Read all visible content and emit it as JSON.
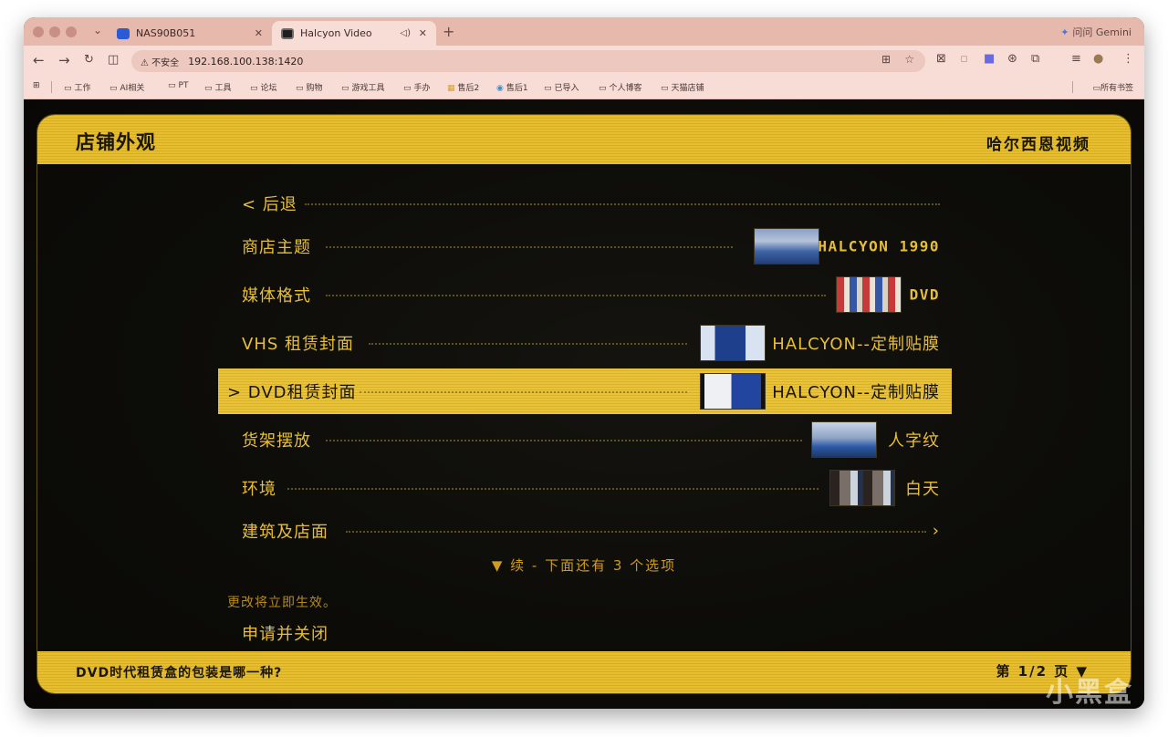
{
  "browser": {
    "tabs": [
      {
        "title": "NAS90B051"
      },
      {
        "title": "Halcyon Video"
      }
    ],
    "gemini_label": "问问 Gemini",
    "security_label": "不安全",
    "url": "192.168.100.138:1420",
    "bookmarks": [
      "工作",
      "AI相关",
      "PT",
      "工具",
      "论坛",
      "购物",
      "游戏工具",
      "手办",
      "售后2",
      "售后1",
      "已导入",
      "个人博客",
      "天猫店铺"
    ],
    "all_bookmarks": "所有书签",
    "colors": {
      "tabbar": "#e7b9ad",
      "toolbar": "#f7ddd5"
    }
  },
  "game": {
    "title": "店铺外观",
    "brand": "哈尔西恩视频",
    "menu": [
      {
        "label": "< 后退",
        "value": ""
      },
      {
        "label": "商店主题",
        "value": "HALCYON 1990"
      },
      {
        "label": "媒体格式",
        "value": "DVD"
      },
      {
        "label": "VHS 租赁封面",
        "value": "HALCYON--定制贴膜"
      },
      {
        "label": "> DVD租赁封面",
        "value": "HALCYON--定制贴膜"
      },
      {
        "label": "货架摆放",
        "value": "人字纹"
      },
      {
        "label": "环境",
        "value": "白天"
      },
      {
        "label": "建筑及店面",
        "value": "›"
      }
    ],
    "more_hint": "▼ 续 - 下面还有 3 个选项",
    "note": "更改将立即生效。",
    "apply_button": "申请并关闭",
    "question": "DVD时代租赁盒的包装是哪一种?",
    "pager": "第 1/2 页 ▼",
    "colors": {
      "accent": "#e8bf32",
      "bar": "#e6be2f",
      "background": "#0c0b08"
    }
  },
  "watermark": "小黑盒"
}
